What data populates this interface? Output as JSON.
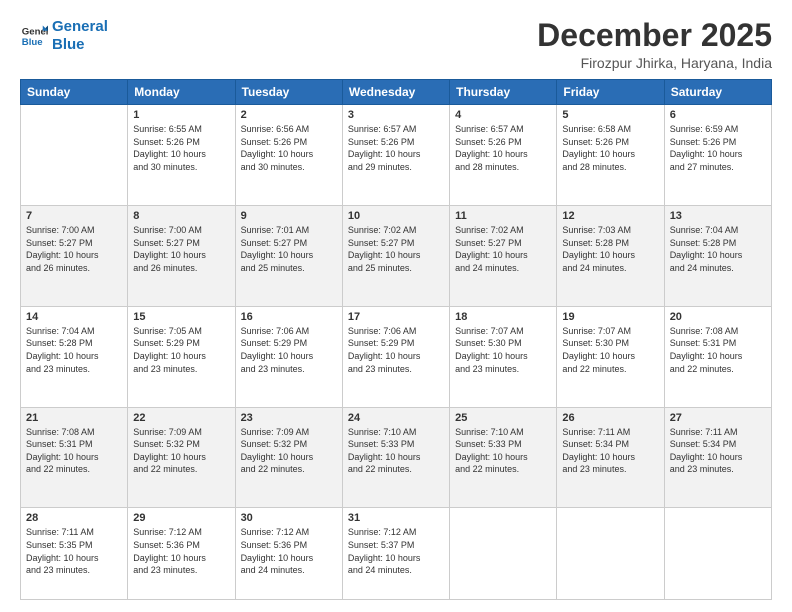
{
  "logo": {
    "line1": "General",
    "line2": "Blue"
  },
  "header": {
    "title": "December 2025",
    "subtitle": "Firozpur Jhirka, Haryana, India"
  },
  "columns": [
    "Sunday",
    "Monday",
    "Tuesday",
    "Wednesday",
    "Thursday",
    "Friday",
    "Saturday"
  ],
  "weeks": [
    [
      {
        "day": "",
        "info": ""
      },
      {
        "day": "1",
        "info": "Sunrise: 6:55 AM\nSunset: 5:26 PM\nDaylight: 10 hours\nand 30 minutes."
      },
      {
        "day": "2",
        "info": "Sunrise: 6:56 AM\nSunset: 5:26 PM\nDaylight: 10 hours\nand 30 minutes."
      },
      {
        "day": "3",
        "info": "Sunrise: 6:57 AM\nSunset: 5:26 PM\nDaylight: 10 hours\nand 29 minutes."
      },
      {
        "day": "4",
        "info": "Sunrise: 6:57 AM\nSunset: 5:26 PM\nDaylight: 10 hours\nand 28 minutes."
      },
      {
        "day": "5",
        "info": "Sunrise: 6:58 AM\nSunset: 5:26 PM\nDaylight: 10 hours\nand 28 minutes."
      },
      {
        "day": "6",
        "info": "Sunrise: 6:59 AM\nSunset: 5:26 PM\nDaylight: 10 hours\nand 27 minutes."
      }
    ],
    [
      {
        "day": "7",
        "info": "Sunrise: 7:00 AM\nSunset: 5:27 PM\nDaylight: 10 hours\nand 26 minutes."
      },
      {
        "day": "8",
        "info": "Sunrise: 7:00 AM\nSunset: 5:27 PM\nDaylight: 10 hours\nand 26 minutes."
      },
      {
        "day": "9",
        "info": "Sunrise: 7:01 AM\nSunset: 5:27 PM\nDaylight: 10 hours\nand 25 minutes."
      },
      {
        "day": "10",
        "info": "Sunrise: 7:02 AM\nSunset: 5:27 PM\nDaylight: 10 hours\nand 25 minutes."
      },
      {
        "day": "11",
        "info": "Sunrise: 7:02 AM\nSunset: 5:27 PM\nDaylight: 10 hours\nand 24 minutes."
      },
      {
        "day": "12",
        "info": "Sunrise: 7:03 AM\nSunset: 5:28 PM\nDaylight: 10 hours\nand 24 minutes."
      },
      {
        "day": "13",
        "info": "Sunrise: 7:04 AM\nSunset: 5:28 PM\nDaylight: 10 hours\nand 24 minutes."
      }
    ],
    [
      {
        "day": "14",
        "info": "Sunrise: 7:04 AM\nSunset: 5:28 PM\nDaylight: 10 hours\nand 23 minutes."
      },
      {
        "day": "15",
        "info": "Sunrise: 7:05 AM\nSunset: 5:29 PM\nDaylight: 10 hours\nand 23 minutes."
      },
      {
        "day": "16",
        "info": "Sunrise: 7:06 AM\nSunset: 5:29 PM\nDaylight: 10 hours\nand 23 minutes."
      },
      {
        "day": "17",
        "info": "Sunrise: 7:06 AM\nSunset: 5:29 PM\nDaylight: 10 hours\nand 23 minutes."
      },
      {
        "day": "18",
        "info": "Sunrise: 7:07 AM\nSunset: 5:30 PM\nDaylight: 10 hours\nand 23 minutes."
      },
      {
        "day": "19",
        "info": "Sunrise: 7:07 AM\nSunset: 5:30 PM\nDaylight: 10 hours\nand 22 minutes."
      },
      {
        "day": "20",
        "info": "Sunrise: 7:08 AM\nSunset: 5:31 PM\nDaylight: 10 hours\nand 22 minutes."
      }
    ],
    [
      {
        "day": "21",
        "info": "Sunrise: 7:08 AM\nSunset: 5:31 PM\nDaylight: 10 hours\nand 22 minutes."
      },
      {
        "day": "22",
        "info": "Sunrise: 7:09 AM\nSunset: 5:32 PM\nDaylight: 10 hours\nand 22 minutes."
      },
      {
        "day": "23",
        "info": "Sunrise: 7:09 AM\nSunset: 5:32 PM\nDaylight: 10 hours\nand 22 minutes."
      },
      {
        "day": "24",
        "info": "Sunrise: 7:10 AM\nSunset: 5:33 PM\nDaylight: 10 hours\nand 22 minutes."
      },
      {
        "day": "25",
        "info": "Sunrise: 7:10 AM\nSunset: 5:33 PM\nDaylight: 10 hours\nand 22 minutes."
      },
      {
        "day": "26",
        "info": "Sunrise: 7:11 AM\nSunset: 5:34 PM\nDaylight: 10 hours\nand 23 minutes."
      },
      {
        "day": "27",
        "info": "Sunrise: 7:11 AM\nSunset: 5:34 PM\nDaylight: 10 hours\nand 23 minutes."
      }
    ],
    [
      {
        "day": "28",
        "info": "Sunrise: 7:11 AM\nSunset: 5:35 PM\nDaylight: 10 hours\nand 23 minutes."
      },
      {
        "day": "29",
        "info": "Sunrise: 7:12 AM\nSunset: 5:36 PM\nDaylight: 10 hours\nand 23 minutes."
      },
      {
        "day": "30",
        "info": "Sunrise: 7:12 AM\nSunset: 5:36 PM\nDaylight: 10 hours\nand 24 minutes."
      },
      {
        "day": "31",
        "info": "Sunrise: 7:12 AM\nSunset: 5:37 PM\nDaylight: 10 hours\nand 24 minutes."
      },
      {
        "day": "",
        "info": ""
      },
      {
        "day": "",
        "info": ""
      },
      {
        "day": "",
        "info": ""
      }
    ]
  ]
}
